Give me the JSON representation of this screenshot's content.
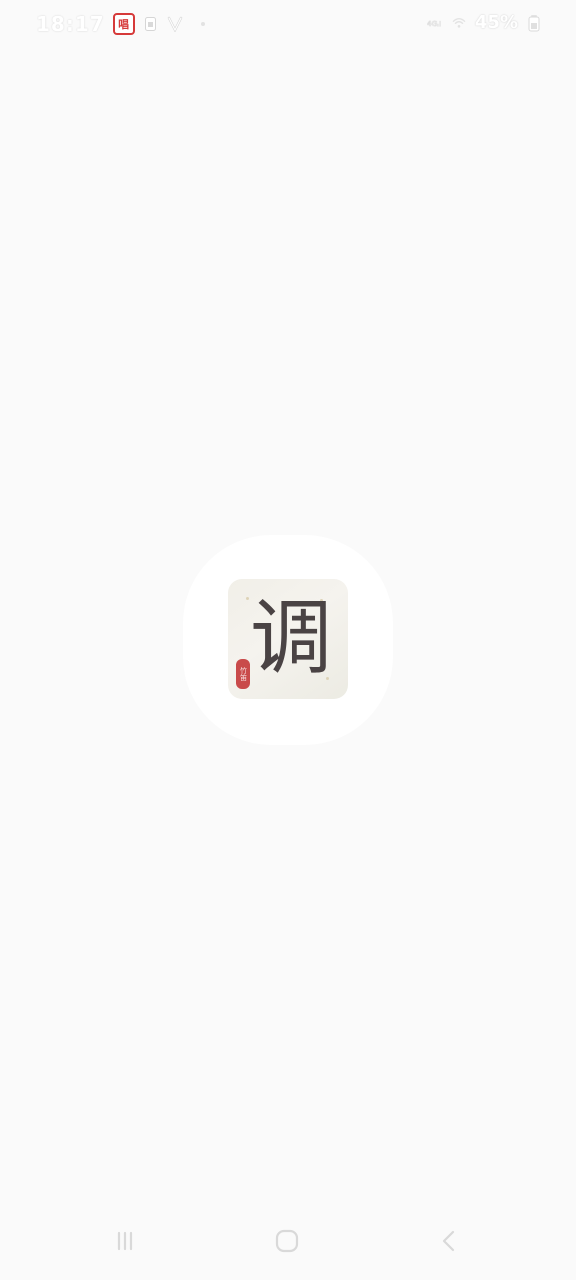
{
  "status_bar": {
    "time": "18:17",
    "app_badge": "唱",
    "network": "4G",
    "battery": "45%"
  },
  "splash": {
    "icon_character": "调",
    "seal_text": "竹笛"
  },
  "nav": {
    "recent": "recent-apps",
    "home": "home",
    "back": "back"
  }
}
